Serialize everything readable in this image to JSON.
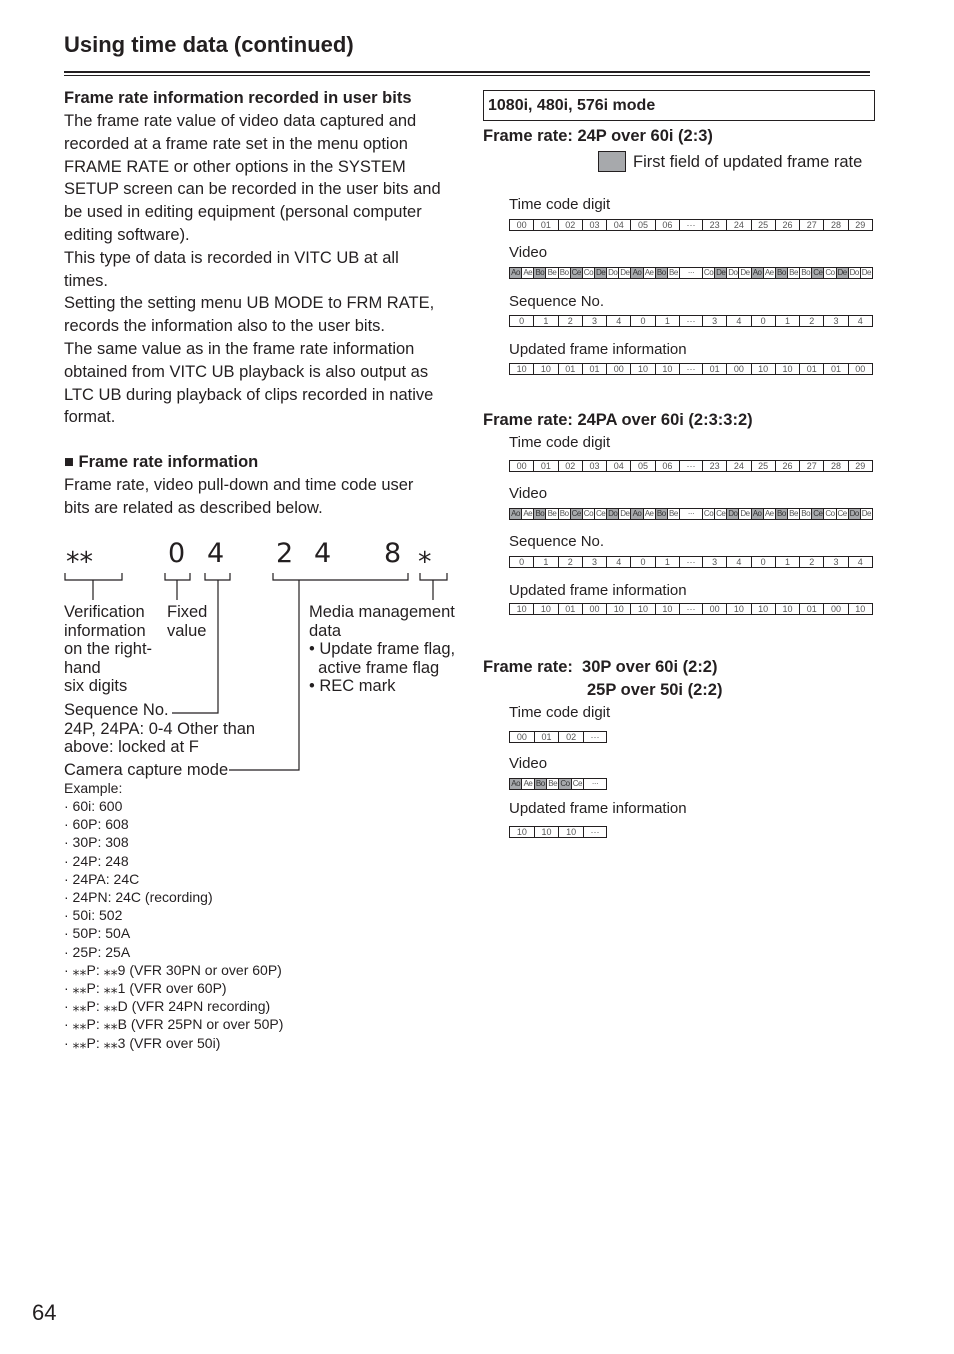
{
  "header": {
    "title": "Using time data (continued)"
  },
  "left": {
    "section1_title": "Frame rate information recorded in user bits",
    "section1_lines": [
      "The frame rate value of video data captured and",
      "recorded at a frame rate set in the menu option",
      "FRAME RATE or other options in the SYSTEM",
      "SETUP screen can be recorded in the user bits and",
      "be used in editing equipment (personal computer",
      "editing software).",
      "This type of data is recorded in VITC UB at all",
      "times.",
      "Setting the setting menu UB MODE to FRM RATE,",
      "records the information also to the user bits.",
      "The same value as in the frame rate information",
      "obtained from VITC UB playback is also output as",
      "LTC UB during playback of clips recorded in native",
      "format."
    ],
    "section2_title": "■ Frame rate information",
    "section2_lines": [
      "Frame rate, video pull-down and time code user",
      "bits are related as described below."
    ],
    "diagram": {
      "symbols": [
        "⁎⁎",
        "0",
        "4",
        "2",
        "4",
        "8",
        "⁎"
      ],
      "verification": [
        "Verification",
        "information",
        "on the right-",
        "hand",
        "six digits"
      ],
      "fixed": [
        "Fixed",
        "value"
      ],
      "media": [
        "Media management",
        "data",
        "• Update frame flag,",
        "  active frame flag",
        "• REC mark"
      ],
      "sequence": [
        "Sequence No.",
        "24P, 24PA: 0-4 Other than",
        "above: locked at F"
      ],
      "camera": "Camera capture mode",
      "example_title": "Example:",
      "examples": [
        "· 60i: 600",
        "· 60P: 608",
        "· 30P: 308",
        "· 24P: 248",
        "· 24PA: 24C",
        "· 24PN: 24C (recording)",
        "· 50i: 502",
        "· 50P: 50A",
        "· 25P: 25A",
        "· ⁎⁎P: ⁎⁎9 (VFR 30PN or over 60P)",
        "· ⁎⁎P: ⁎⁎1 (VFR over 60P)",
        "· ⁎⁎P: ⁎⁎D (VFR 24PN recording)",
        "· ⁎⁎P: ⁎⁎B (VFR 25PN or over 50P)",
        "· ⁎⁎P: ⁎⁎3 (VFR over 50i)"
      ]
    }
  },
  "right": {
    "mode": "1080i, 480i, 576i mode",
    "legend": "First field of updated frame rate",
    "shade_color": "#a7a9ac",
    "labels": {
      "tc": "Time code digit",
      "video": "Video",
      "seq": "Sequence No.",
      "upd": "Updated frame information"
    },
    "blocks": [
      {
        "title": "Frame rate: 24P over 60i (2:3)",
        "tc": [
          "00",
          "01",
          "02",
          "03",
          "04",
          "05",
          "06",
          "···",
          "23",
          "24",
          "25",
          "26",
          "27",
          "28",
          "29"
        ],
        "video": [
          "Ao",
          "Ae",
          "Bo",
          "Be",
          "Bo",
          "Ce",
          "Co",
          "De",
          "Do",
          "De",
          "Ao",
          "Ae",
          "Bo",
          "Be",
          "···",
          "Co",
          "De",
          "Do",
          "De",
          "Ao",
          "Ae",
          "Bo",
          "Be",
          "Bo",
          "Ce",
          "Co",
          "De",
          "Do",
          "De"
        ],
        "video_shaded": [
          0,
          2,
          5,
          7,
          10,
          12,
          16,
          19,
          21,
          24,
          26
        ],
        "seq": [
          "0",
          "1",
          "2",
          "3",
          "4",
          "0",
          "1",
          "···",
          "3",
          "4",
          "0",
          "1",
          "2",
          "3",
          "4"
        ],
        "upd": [
          "10",
          "10",
          "01",
          "01",
          "00",
          "10",
          "10",
          "···",
          "01",
          "00",
          "10",
          "10",
          "01",
          "01",
          "00"
        ]
      },
      {
        "title": "Frame rate: 24PA over 60i (2:3:3:2)",
        "tc": [
          "00",
          "01",
          "02",
          "03",
          "04",
          "05",
          "06",
          "···",
          "23",
          "24",
          "25",
          "26",
          "27",
          "28",
          "29"
        ],
        "video": [
          "Ao",
          "Ae",
          "Bo",
          "Be",
          "Bo",
          "Ce",
          "Co",
          "Ce",
          "Do",
          "De",
          "Ao",
          "Ae",
          "Bo",
          "Be",
          "···",
          "Co",
          "Ce",
          "Do",
          "De",
          "Ao",
          "Ae",
          "Bo",
          "Be",
          "Bo",
          "Ce",
          "Co",
          "Ce",
          "Do",
          "De"
        ],
        "video_shaded": [
          0,
          2,
          5,
          8,
          10,
          12,
          17,
          19,
          21,
          24,
          27
        ],
        "seq": [
          "0",
          "1",
          "2",
          "3",
          "4",
          "0",
          "1",
          "···",
          "3",
          "4",
          "0",
          "1",
          "2",
          "3",
          "4"
        ],
        "upd": [
          "10",
          "10",
          "01",
          "00",
          "10",
          "10",
          "10",
          "···",
          "00",
          "10",
          "10",
          "10",
          "01",
          "00",
          "10"
        ]
      },
      {
        "title_lines": [
          "Frame rate:  30P over 60i (2:2)",
          "25P over 50i (2:2)"
        ],
        "tc": [
          "00",
          "01",
          "02",
          "···"
        ],
        "video": [
          "Ao",
          "Ae",
          "Bo",
          "Be",
          "Co",
          "Ce",
          "···"
        ],
        "video_shaded": [
          0,
          2,
          4
        ],
        "upd": [
          "10",
          "10",
          "10",
          "···"
        ]
      }
    ]
  },
  "footer": {
    "page_number": "64"
  }
}
